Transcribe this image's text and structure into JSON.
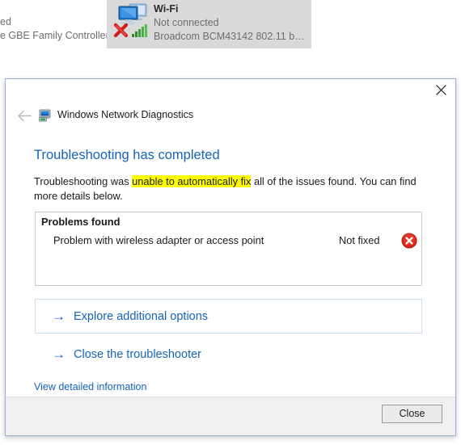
{
  "background": {
    "left_fragments": [
      "ed",
      "e GBE Family Controller"
    ],
    "wifi_item": {
      "name": "Wi-Fi",
      "status": "Not connected",
      "adapter": "Broadcom BCM43142 802.11 bgn ...",
      "selection_color": "#d9d9d9",
      "error_icon": "red-x-icon",
      "signal_icon": "signal-bars-icon",
      "device_icon": "network-computers-icon"
    }
  },
  "dialog": {
    "app_title": "Windows Network Diagnostics",
    "app_icon": "network-diagnostics-icon",
    "back_icon": "back-arrow-icon",
    "close_icon": "close-x-icon",
    "heading": "Troubleshooting has completed",
    "heading_color": "#1763b5",
    "intro": {
      "before": "Troubleshooting was ",
      "highlight": "unable to automatically fix",
      "after": " all of the issues found. You can find more details below.",
      "highlight_color": "#ffff00"
    },
    "problems": {
      "title": "Problems found",
      "rows": [
        {
          "label": "Problem with wireless adapter or access point",
          "status": "Not fixed",
          "icon": "error-circle-icon",
          "icon_color": "#d9291c"
        }
      ]
    },
    "actions": [
      {
        "label": "Explore additional options",
        "arrow": "→",
        "focused": true
      },
      {
        "label": "Close the troubleshooter",
        "arrow": "→",
        "focused": false
      }
    ],
    "detail_link": "View detailed information",
    "footer": {
      "close_label": "Close"
    }
  }
}
